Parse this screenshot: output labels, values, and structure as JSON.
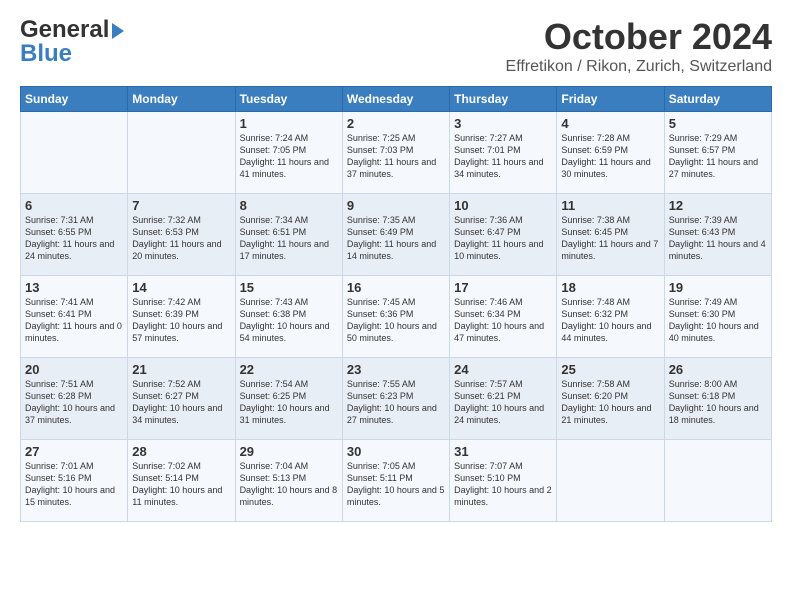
{
  "header": {
    "logo_general": "General",
    "logo_blue": "Blue",
    "month_title": "October 2024",
    "location": "Effretikon / Rikon, Zurich, Switzerland"
  },
  "weekdays": [
    "Sunday",
    "Monday",
    "Tuesday",
    "Wednesday",
    "Thursday",
    "Friday",
    "Saturday"
  ],
  "weeks": [
    [
      {
        "day": "",
        "sunrise": "",
        "sunset": "",
        "daylight": ""
      },
      {
        "day": "",
        "sunrise": "",
        "sunset": "",
        "daylight": ""
      },
      {
        "day": "1",
        "sunrise": "Sunrise: 7:24 AM",
        "sunset": "Sunset: 7:05 PM",
        "daylight": "Daylight: 11 hours and 41 minutes."
      },
      {
        "day": "2",
        "sunrise": "Sunrise: 7:25 AM",
        "sunset": "Sunset: 7:03 PM",
        "daylight": "Daylight: 11 hours and 37 minutes."
      },
      {
        "day": "3",
        "sunrise": "Sunrise: 7:27 AM",
        "sunset": "Sunset: 7:01 PM",
        "daylight": "Daylight: 11 hours and 34 minutes."
      },
      {
        "day": "4",
        "sunrise": "Sunrise: 7:28 AM",
        "sunset": "Sunset: 6:59 PM",
        "daylight": "Daylight: 11 hours and 30 minutes."
      },
      {
        "day": "5",
        "sunrise": "Sunrise: 7:29 AM",
        "sunset": "Sunset: 6:57 PM",
        "daylight": "Daylight: 11 hours and 27 minutes."
      }
    ],
    [
      {
        "day": "6",
        "sunrise": "Sunrise: 7:31 AM",
        "sunset": "Sunset: 6:55 PM",
        "daylight": "Daylight: 11 hours and 24 minutes."
      },
      {
        "day": "7",
        "sunrise": "Sunrise: 7:32 AM",
        "sunset": "Sunset: 6:53 PM",
        "daylight": "Daylight: 11 hours and 20 minutes."
      },
      {
        "day": "8",
        "sunrise": "Sunrise: 7:34 AM",
        "sunset": "Sunset: 6:51 PM",
        "daylight": "Daylight: 11 hours and 17 minutes."
      },
      {
        "day": "9",
        "sunrise": "Sunrise: 7:35 AM",
        "sunset": "Sunset: 6:49 PM",
        "daylight": "Daylight: 11 hours and 14 minutes."
      },
      {
        "day": "10",
        "sunrise": "Sunrise: 7:36 AM",
        "sunset": "Sunset: 6:47 PM",
        "daylight": "Daylight: 11 hours and 10 minutes."
      },
      {
        "day": "11",
        "sunrise": "Sunrise: 7:38 AM",
        "sunset": "Sunset: 6:45 PM",
        "daylight": "Daylight: 11 hours and 7 minutes."
      },
      {
        "day": "12",
        "sunrise": "Sunrise: 7:39 AM",
        "sunset": "Sunset: 6:43 PM",
        "daylight": "Daylight: 11 hours and 4 minutes."
      }
    ],
    [
      {
        "day": "13",
        "sunrise": "Sunrise: 7:41 AM",
        "sunset": "Sunset: 6:41 PM",
        "daylight": "Daylight: 11 hours and 0 minutes."
      },
      {
        "day": "14",
        "sunrise": "Sunrise: 7:42 AM",
        "sunset": "Sunset: 6:39 PM",
        "daylight": "Daylight: 10 hours and 57 minutes."
      },
      {
        "day": "15",
        "sunrise": "Sunrise: 7:43 AM",
        "sunset": "Sunset: 6:38 PM",
        "daylight": "Daylight: 10 hours and 54 minutes."
      },
      {
        "day": "16",
        "sunrise": "Sunrise: 7:45 AM",
        "sunset": "Sunset: 6:36 PM",
        "daylight": "Daylight: 10 hours and 50 minutes."
      },
      {
        "day": "17",
        "sunrise": "Sunrise: 7:46 AM",
        "sunset": "Sunset: 6:34 PM",
        "daylight": "Daylight: 10 hours and 47 minutes."
      },
      {
        "day": "18",
        "sunrise": "Sunrise: 7:48 AM",
        "sunset": "Sunset: 6:32 PM",
        "daylight": "Daylight: 10 hours and 44 minutes."
      },
      {
        "day": "19",
        "sunrise": "Sunrise: 7:49 AM",
        "sunset": "Sunset: 6:30 PM",
        "daylight": "Daylight: 10 hours and 40 minutes."
      }
    ],
    [
      {
        "day": "20",
        "sunrise": "Sunrise: 7:51 AM",
        "sunset": "Sunset: 6:28 PM",
        "daylight": "Daylight: 10 hours and 37 minutes."
      },
      {
        "day": "21",
        "sunrise": "Sunrise: 7:52 AM",
        "sunset": "Sunset: 6:27 PM",
        "daylight": "Daylight: 10 hours and 34 minutes."
      },
      {
        "day": "22",
        "sunrise": "Sunrise: 7:54 AM",
        "sunset": "Sunset: 6:25 PM",
        "daylight": "Daylight: 10 hours and 31 minutes."
      },
      {
        "day": "23",
        "sunrise": "Sunrise: 7:55 AM",
        "sunset": "Sunset: 6:23 PM",
        "daylight": "Daylight: 10 hours and 27 minutes."
      },
      {
        "day": "24",
        "sunrise": "Sunrise: 7:57 AM",
        "sunset": "Sunset: 6:21 PM",
        "daylight": "Daylight: 10 hours and 24 minutes."
      },
      {
        "day": "25",
        "sunrise": "Sunrise: 7:58 AM",
        "sunset": "Sunset: 6:20 PM",
        "daylight": "Daylight: 10 hours and 21 minutes."
      },
      {
        "day": "26",
        "sunrise": "Sunrise: 8:00 AM",
        "sunset": "Sunset: 6:18 PM",
        "daylight": "Daylight: 10 hours and 18 minutes."
      }
    ],
    [
      {
        "day": "27",
        "sunrise": "Sunrise: 7:01 AM",
        "sunset": "Sunset: 5:16 PM",
        "daylight": "Daylight: 10 hours and 15 minutes."
      },
      {
        "day": "28",
        "sunrise": "Sunrise: 7:02 AM",
        "sunset": "Sunset: 5:14 PM",
        "daylight": "Daylight: 10 hours and 11 minutes."
      },
      {
        "day": "29",
        "sunrise": "Sunrise: 7:04 AM",
        "sunset": "Sunset: 5:13 PM",
        "daylight": "Daylight: 10 hours and 8 minutes."
      },
      {
        "day": "30",
        "sunrise": "Sunrise: 7:05 AM",
        "sunset": "Sunset: 5:11 PM",
        "daylight": "Daylight: 10 hours and 5 minutes."
      },
      {
        "day": "31",
        "sunrise": "Sunrise: 7:07 AM",
        "sunset": "Sunset: 5:10 PM",
        "daylight": "Daylight: 10 hours and 2 minutes."
      },
      {
        "day": "",
        "sunrise": "",
        "sunset": "",
        "daylight": ""
      },
      {
        "day": "",
        "sunrise": "",
        "sunset": "",
        "daylight": ""
      }
    ]
  ]
}
